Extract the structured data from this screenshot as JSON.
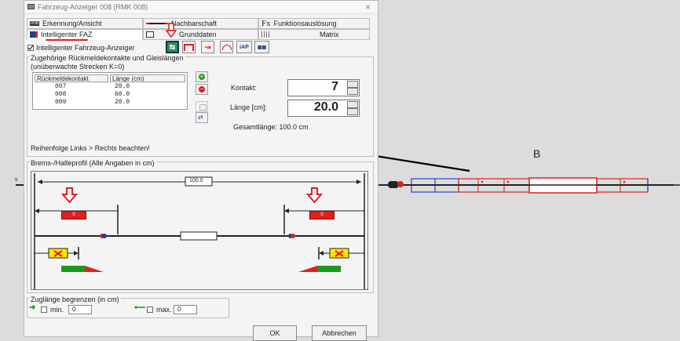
{
  "window": {
    "title": "Fahrzeug-Anzeiger 008 (RMK 008)",
    "close_glyph": "×"
  },
  "tabs_row1": [
    {
      "label": "Erkennung/Ansicht",
      "icon": "id-badge-icon",
      "badge": "008"
    },
    {
      "label": "Nachbarschaft",
      "icon": "neighbour-link-icon"
    },
    {
      "label": "Funktionsauslösung",
      "icon": "function-fx-icon",
      "badge": "Fx"
    }
  ],
  "tabs_row2": [
    {
      "label": "Intelligenter FAZ",
      "icon": "smart-vehicle-icon",
      "active": true
    },
    {
      "label": "Grunddaten",
      "icon": "document-icon"
    },
    {
      "label": "Matrix",
      "icon": "matrix-grid-icon"
    }
  ],
  "toolbar": {
    "smart_checkbox_label": "Intelligenter Fahrzeug-Anzeiger",
    "smart_checked": true,
    "buttons": [
      "iAP",
      "▦▦"
    ]
  },
  "feedback_group": {
    "caption": "Zugehörige Rückmeldekontakte und Gleislängen",
    "subcaption": "(unüberwachte Strecken K=0)",
    "columns": [
      "Rückmeldekontakt",
      "Länge (cm)"
    ],
    "rows": [
      {
        "contact": "007",
        "length": "20.0"
      },
      {
        "contact": "008",
        "length": "60.0"
      },
      {
        "contact": "009",
        "length": "20.0"
      }
    ],
    "order_note": "Reihenfolge Links > Rechts beachten!",
    "contact_label": "Kontakt:",
    "contact_value": "7",
    "length_label": "Länge [cm]:",
    "length_value": "20.0",
    "total_label": "Gesamtlänge: 100.0 cm"
  },
  "brake_group": {
    "caption": "Brems-/Halteprofil (Alle Angaben in cm)",
    "total_length": "100.0",
    "left_marker": "0",
    "right_marker": "0"
  },
  "train_length": {
    "caption": "Zuglänge begrenzen (in cm)",
    "min_label": "min.",
    "min_value": "0",
    "max_label": "max.",
    "max_value": "0"
  },
  "buttons": {
    "ok": "OK",
    "cancel": "Abbrechen"
  },
  "annotation": {
    "label": "B"
  },
  "track": {
    "left_label": "s"
  },
  "colors": {
    "accent_red": "#e02020",
    "block_blue": "#2b3fd6",
    "arrow_green": "#1a9a1a"
  }
}
